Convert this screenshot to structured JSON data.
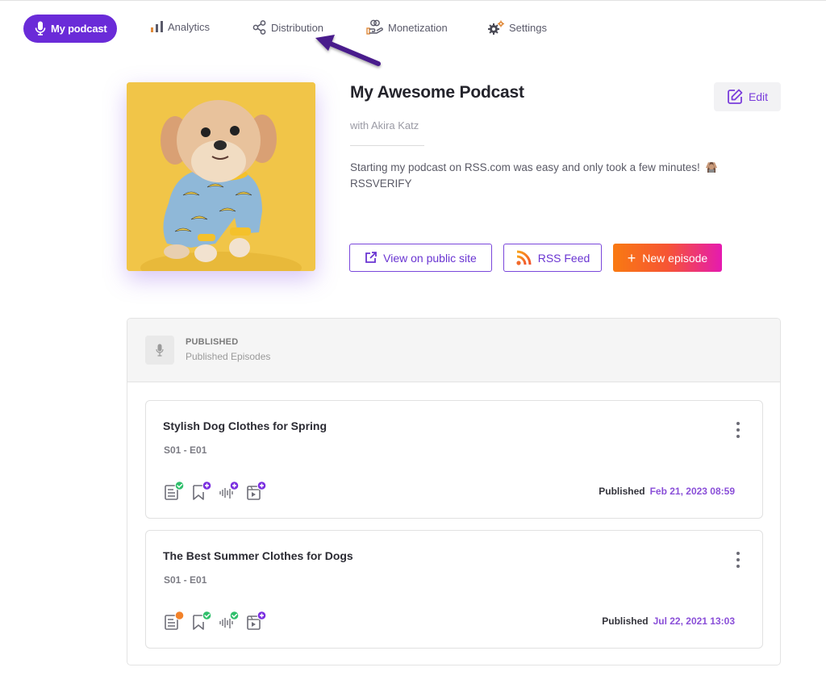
{
  "nav": {
    "items": [
      {
        "label": "My podcast",
        "icon": "microphone-icon",
        "active": true
      },
      {
        "label": "Analytics",
        "icon": "bar-chart-icon",
        "active": false
      },
      {
        "label": "Distribution",
        "icon": "share-icon",
        "active": false
      },
      {
        "label": "Monetization",
        "icon": "hand-coins-icon",
        "active": false
      },
      {
        "label": "Settings",
        "icon": "gears-icon",
        "active": false
      }
    ],
    "active_color": "#6a2bd8"
  },
  "annotation": {
    "type": "arrow",
    "points_to": "Distribution",
    "color": "#4a1a8c"
  },
  "podcast": {
    "cover_alt": "Small fluffy dog wearing blue banana-print pajamas on yellow background",
    "title": "My Awesome Podcast",
    "author": "with Akira Katz",
    "description": "Starting my podcast on RSS.com was easy and only took a few minutes!",
    "description_emoji": "person-gesturing-icon",
    "verify_code": "RSSVERIFY"
  },
  "actions": {
    "edit": "Edit",
    "view_public": "View on public site",
    "rss_feed": "RSS Feed",
    "new_episode": "New episode",
    "new_episode_prefix": "+"
  },
  "published_panel": {
    "title": "PUBLISHED",
    "subtitle": "Published Episodes"
  },
  "episodes": [
    {
      "title": "Stylish Dog Clothes for Spring",
      "number": "S01 - E01",
      "status_label": "Published",
      "date": "Feb 21, 2023 08:59",
      "badges": [
        {
          "icon": "transcript-icon",
          "state": "done"
        },
        {
          "icon": "chapters-icon",
          "state": "add"
        },
        {
          "icon": "audio-icon",
          "state": "add"
        },
        {
          "icon": "video-icon",
          "state": "add"
        }
      ]
    },
    {
      "title": "The Best Summer Clothes for Dogs",
      "number": "S01 - E01",
      "status_label": "Published",
      "date": "Jul 22, 2021 13:03",
      "badges": [
        {
          "icon": "transcript-icon",
          "state": "pending"
        },
        {
          "icon": "chapters-icon",
          "state": "done"
        },
        {
          "icon": "audio-icon",
          "state": "done"
        },
        {
          "icon": "video-icon",
          "state": "add"
        }
      ]
    }
  ],
  "colors": {
    "done": "#2fbf6b",
    "add": "#7a2ee0",
    "pending": "#f2822a",
    "date": "#8a4fd8"
  }
}
